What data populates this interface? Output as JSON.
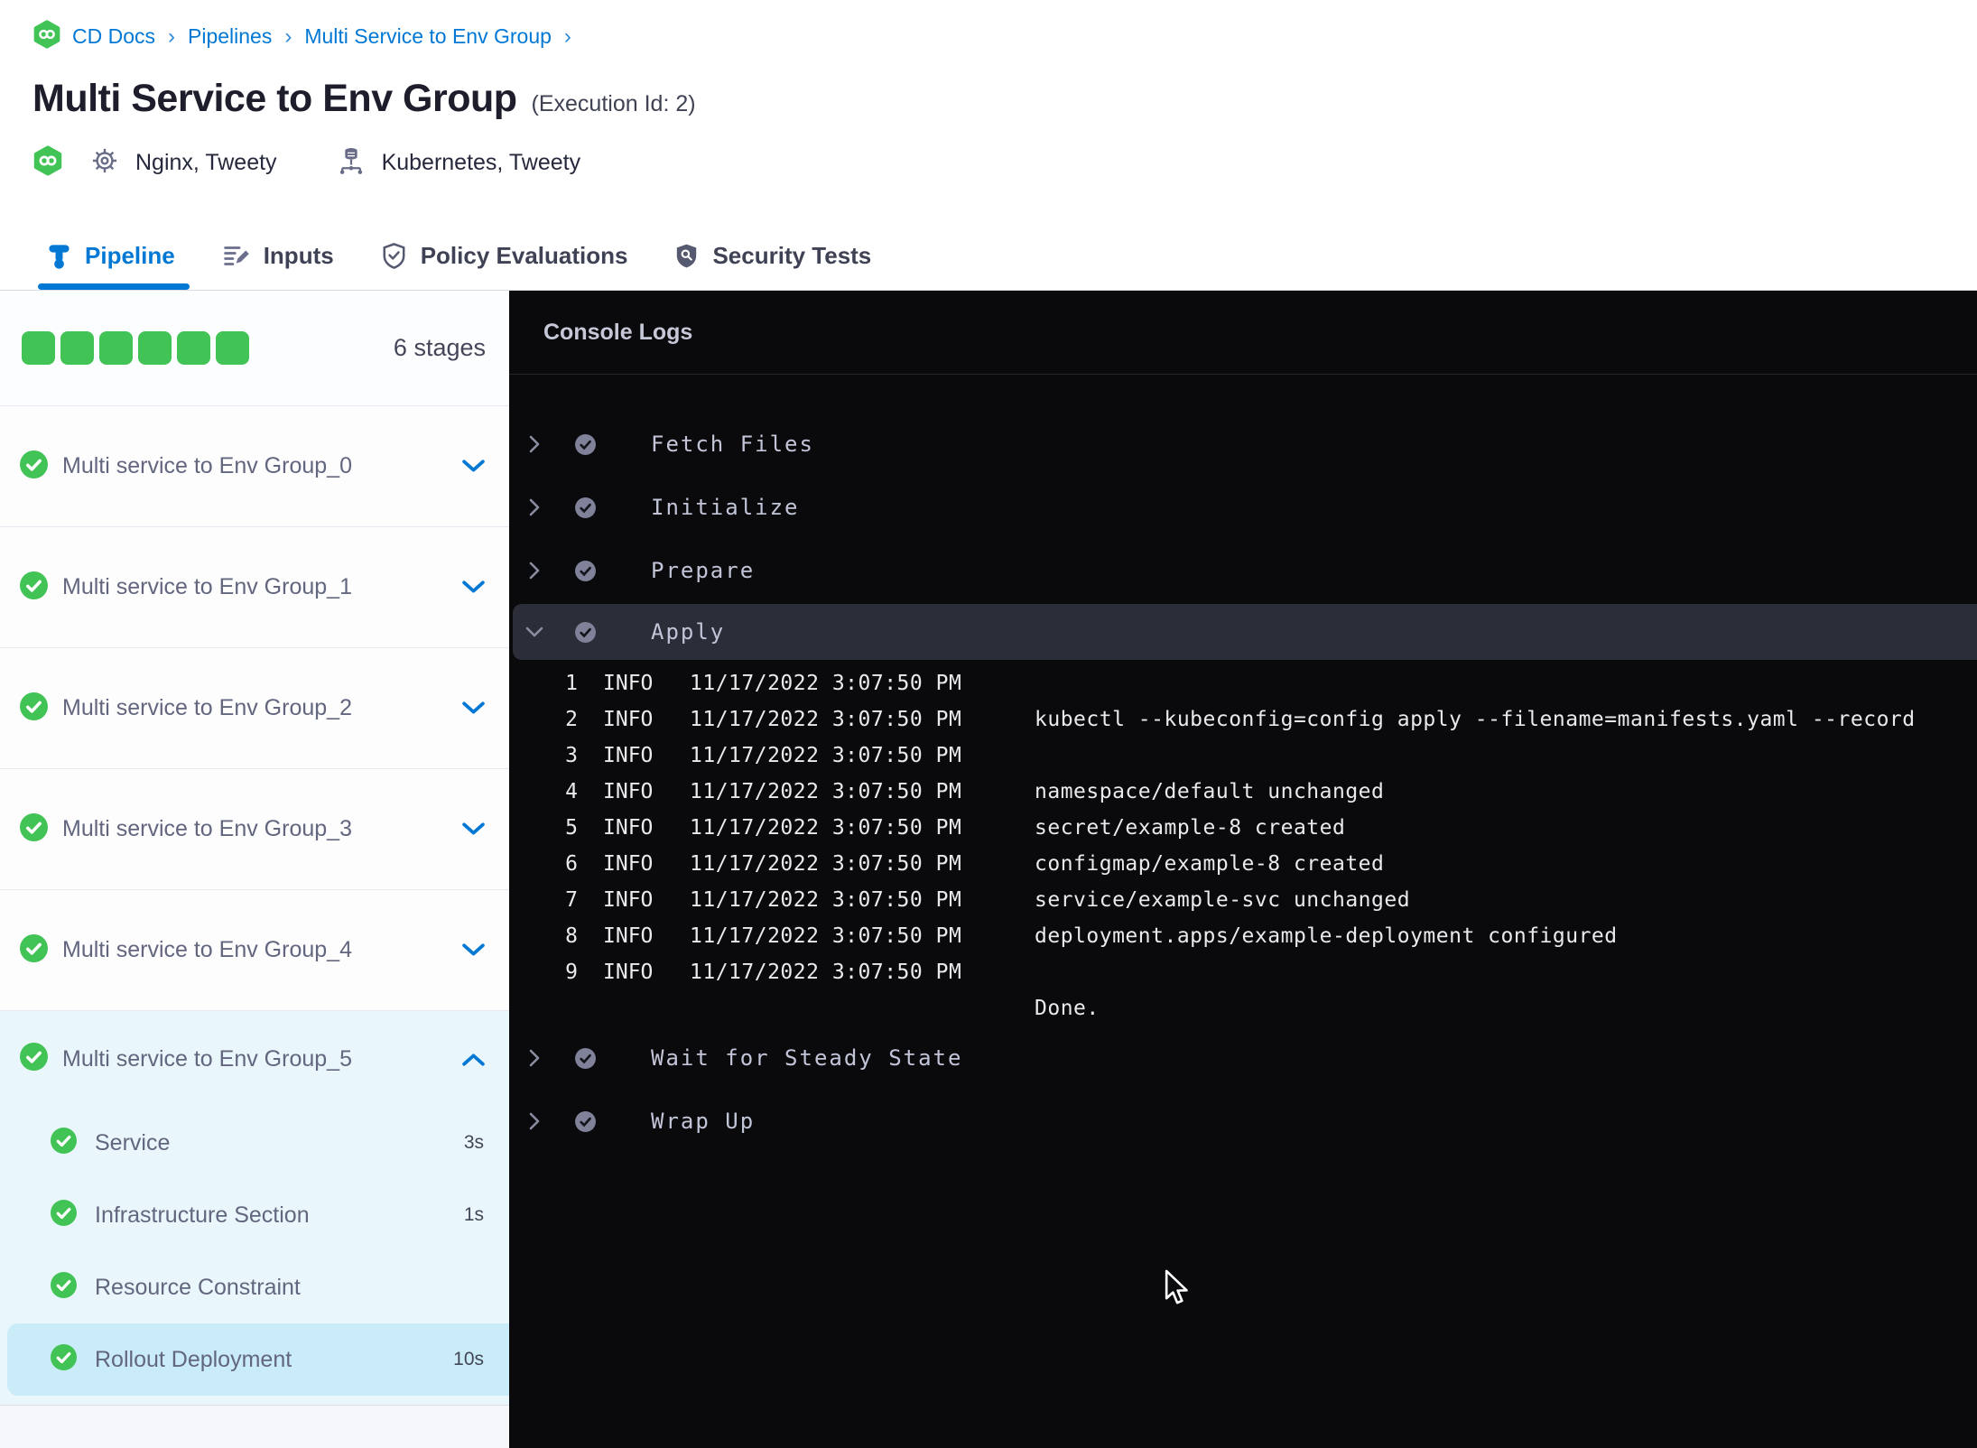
{
  "breadcrumb": {
    "items": [
      "CD Docs",
      "Pipelines",
      "Multi Service to Env Group"
    ],
    "separator": "›"
  },
  "header": {
    "title": "Multi Service to Env Group",
    "execution_id": "(Execution Id: 2)",
    "services_label": "Nginx, Tweety",
    "environments_label": "Kubernetes, Tweety"
  },
  "tabs": [
    {
      "label": "Pipeline",
      "active": true
    },
    {
      "label": "Inputs",
      "active": false
    },
    {
      "label": "Policy Evaluations",
      "active": false
    },
    {
      "label": "Security Tests",
      "active": false
    }
  ],
  "stages_panel": {
    "stage_count_label": "6 stages",
    "progress_squares": 6,
    "collapsed_stages": [
      "Multi service to Env Group_0",
      "Multi service to Env Group_1",
      "Multi service to Env Group_2",
      "Multi service to Env Group_3",
      "Multi service to Env Group_4"
    ],
    "expanded_stage": {
      "name": "Multi service to Env Group_5",
      "steps": [
        {
          "label": "Service",
          "duration": "3s",
          "selected": false
        },
        {
          "label": "Infrastructure Section",
          "duration": "1s",
          "selected": false
        },
        {
          "label": "Resource Constraint",
          "duration": "",
          "selected": false
        },
        {
          "label": "Rollout Deployment",
          "duration": "10s",
          "selected": true
        }
      ]
    }
  },
  "console": {
    "title": "Console Logs",
    "steps": [
      {
        "label": "Fetch Files",
        "expanded": false
      },
      {
        "label": "Initialize",
        "expanded": false
      },
      {
        "label": "Prepare",
        "expanded": false
      },
      {
        "label": "Apply",
        "expanded": true
      },
      {
        "label": "Wait for Steady State",
        "expanded": false
      },
      {
        "label": "Wrap Up",
        "expanded": false
      }
    ],
    "log_lines": [
      {
        "num": "1",
        "level": "INFO",
        "time": "11/17/2022 3:07:50 PM",
        "message": ""
      },
      {
        "num": "2",
        "level": "INFO",
        "time": "11/17/2022 3:07:50 PM",
        "message": "kubectl --kubeconfig=config apply --filename=manifests.yaml --record"
      },
      {
        "num": "3",
        "level": "INFO",
        "time": "11/17/2022 3:07:50 PM",
        "message": ""
      },
      {
        "num": "4",
        "level": "INFO",
        "time": "11/17/2022 3:07:50 PM",
        "message": "namespace/default unchanged"
      },
      {
        "num": "5",
        "level": "INFO",
        "time": "11/17/2022 3:07:50 PM",
        "message": "secret/example-8 created"
      },
      {
        "num": "6",
        "level": "INFO",
        "time": "11/17/2022 3:07:50 PM",
        "message": "configmap/example-8 created"
      },
      {
        "num": "7",
        "level": "INFO",
        "time": "11/17/2022 3:07:50 PM",
        "message": "service/example-svc unchanged"
      },
      {
        "num": "8",
        "level": "INFO",
        "time": "11/17/2022 3:07:50 PM",
        "message": "deployment.apps/example-deployment configured"
      },
      {
        "num": "9",
        "level": "INFO",
        "time": "11/17/2022 3:07:50 PM",
        "message": ""
      },
      {
        "num": "",
        "level": "",
        "time": "",
        "message": "Done."
      }
    ]
  },
  "colors": {
    "primary_blue": "#0278d5",
    "success_green": "#42c355",
    "console_bg": "#0a0a0d",
    "expanded_stage_bg": "#e9f6fb",
    "selected_step_bg": "#c9ecf8",
    "apply_band_bg": "#2b2d38"
  }
}
